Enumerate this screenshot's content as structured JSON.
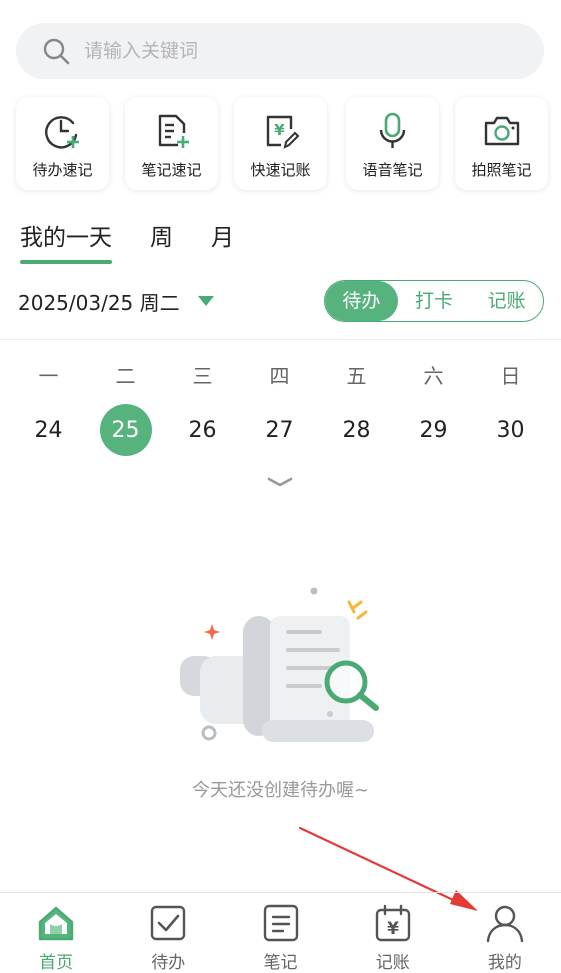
{
  "search": {
    "placeholder": "请输入关键词"
  },
  "quick_actions": [
    {
      "icon": "clock-plus-icon",
      "label": "待办速记"
    },
    {
      "icon": "note-plus-icon",
      "label": "笔记速记"
    },
    {
      "icon": "yen-edit-icon",
      "label": "快速记账"
    },
    {
      "icon": "microphone-icon",
      "label": "语音笔记"
    },
    {
      "icon": "camera-icon",
      "label": "拍照笔记"
    }
  ],
  "view_tabs": [
    {
      "label": "我的一天",
      "active": true
    },
    {
      "label": "周",
      "active": false
    },
    {
      "label": "月",
      "active": false
    }
  ],
  "date_selector": {
    "text": "2025/03/25 周二"
  },
  "segment": [
    {
      "label": "待办",
      "active": true
    },
    {
      "label": "打卡",
      "active": false
    },
    {
      "label": "记账",
      "active": false
    }
  ],
  "week": {
    "days": [
      "一",
      "二",
      "三",
      "四",
      "五",
      "六",
      "日"
    ],
    "dates": [
      "24",
      "25",
      "26",
      "27",
      "28",
      "29",
      "30"
    ],
    "selected_index": 1
  },
  "empty_state": {
    "text": "今天还没创建待办喔~"
  },
  "bottom_nav": [
    {
      "icon": "home-icon",
      "label": "首页",
      "active": true
    },
    {
      "icon": "checkbox-icon",
      "label": "待办",
      "active": false
    },
    {
      "icon": "note-icon",
      "label": "笔记",
      "active": false
    },
    {
      "icon": "calendar-yen-icon",
      "label": "记账",
      "active": false
    },
    {
      "icon": "person-icon",
      "label": "我的",
      "active": false
    }
  ],
  "colors": {
    "accent": "#4aaa74",
    "annotation_arrow": "#e53935"
  }
}
